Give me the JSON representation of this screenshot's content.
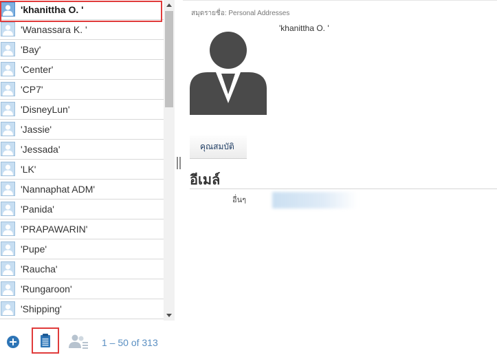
{
  "contacts": [
    {
      "name": "'khanittha O. '",
      "selected": true
    },
    {
      "name": "'Wanassara K. '"
    },
    {
      "name": "'Bay'"
    },
    {
      "name": "'Center'"
    },
    {
      "name": "'CP7'"
    },
    {
      "name": "'DisneyLun'"
    },
    {
      "name": "'Jassie'"
    },
    {
      "name": "'Jessada'"
    },
    {
      "name": "'LK'"
    },
    {
      "name": "'Nannaphat ADM'"
    },
    {
      "name": "'Panida'"
    },
    {
      "name": "'PRAPAWARIN'"
    },
    {
      "name": "'Pupe'"
    },
    {
      "name": "'Raucha'"
    },
    {
      "name": "'Rungaroon'"
    },
    {
      "name": "'Shipping'"
    },
    {
      "name": ""
    }
  ],
  "toolbar": {
    "pager_text": "1 – 50 of 313"
  },
  "detail": {
    "address_book_label": "สมุดรายชื่อ: Personal Addresses",
    "contact_name": "'khanittha O. '",
    "properties_tab_label": "คุณสมบัติ",
    "email_heading": "อีเมล์",
    "email_other_label": "อื่นๆ"
  },
  "icons": {
    "add": "plus-circle-icon",
    "clipboard": "clipboard-icon",
    "group": "people-group-icon",
    "avatar": "person-avatar-icon"
  },
  "colors": {
    "accent": "#2e75b6",
    "selection_border": "#e03a3a",
    "pager_text": "#5a8fc2"
  }
}
